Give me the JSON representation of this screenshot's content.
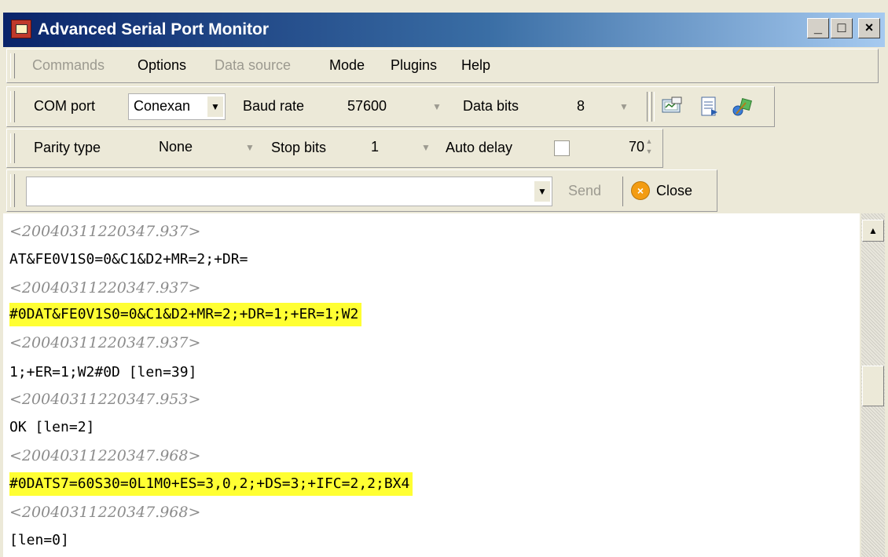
{
  "window": {
    "title": "Advanced Serial Port Monitor",
    "min": "_",
    "max": "□",
    "close": "×"
  },
  "menu": [
    "Commands",
    "Options",
    "Data source",
    "Mode",
    "Plugins",
    "Help"
  ],
  "toolbar1": {
    "com_port_label": "COM port",
    "com_port_value": "Conexan",
    "baud_rate_label": "Baud rate",
    "baud_rate_value": "57600",
    "data_bits_label": "Data bits",
    "data_bits_value": "8"
  },
  "toolbar2": {
    "parity_label": "Parity type",
    "parity_value": "None",
    "stop_bits_label": "Stop bits",
    "stop_bits_value": "1",
    "auto_delay_label": "Auto delay",
    "auto_delay_checked": false,
    "auto_delay_value": "70"
  },
  "toolbar3": {
    "send_input_value": "",
    "send_label": "Send",
    "close_label": "Close"
  },
  "log": [
    {
      "kind": "ts",
      "text": "<20040311220347.937>"
    },
    {
      "kind": "data",
      "text": "AT&FE0V1S0=0&C1&D2+MR=2;+DR="
    },
    {
      "kind": "ts",
      "text": "<20040311220347.937>"
    },
    {
      "kind": "hl",
      "text": "#0DAT&FE0V1S0=0&C1&D2+MR=2;+DR=1;+ER=1;W2"
    },
    {
      "kind": "ts",
      "text": "<20040311220347.937>"
    },
    {
      "kind": "data",
      "text": "1;+ER=1;W2#0D [len=39]"
    },
    {
      "kind": "ts",
      "text": "<20040311220347.953>"
    },
    {
      "kind": "data",
      "text": "OK [len=2]"
    },
    {
      "kind": "ts",
      "text": "<20040311220347.968>"
    },
    {
      "kind": "hl",
      "text": "#0DATS7=60S30=0L1M0+ES=3,0,2;+DS=3;+IFC=2,2;BX4"
    },
    {
      "kind": "ts",
      "text": "<20040311220347.968>"
    },
    {
      "kind": "data",
      "text": "[len=0]"
    }
  ],
  "icons": [
    "monitor-icon",
    "document-icon",
    "plugin-icon"
  ]
}
